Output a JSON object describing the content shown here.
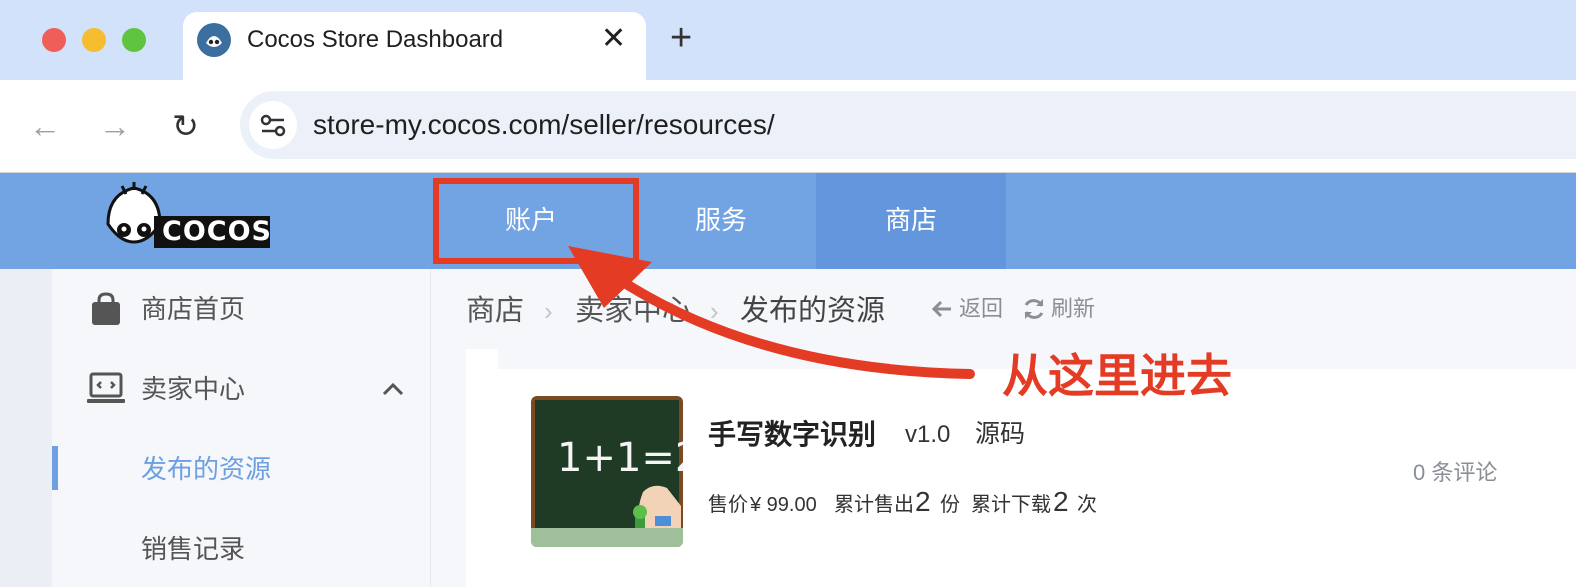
{
  "browser": {
    "tab_title": "Cocos Store Dashboard",
    "tab_close": "✕",
    "new_tab": "+",
    "url": "store-my.cocos.com/seller/resources/",
    "back": "←",
    "forward": "→",
    "reload": "↻"
  },
  "site": {
    "logo_text": "COCOS",
    "nav": [
      {
        "label": "账户"
      },
      {
        "label": "服务"
      },
      {
        "label": "商店"
      }
    ],
    "sidebar": {
      "items": [
        {
          "label": "商店首页"
        },
        {
          "label": "卖家中心"
        },
        {
          "label": "发布的资源"
        },
        {
          "label": "销售记录"
        }
      ]
    },
    "breadcrumb": [
      "商店",
      "卖家中心",
      "发布的资源"
    ],
    "breadcrumb_sep": "›",
    "back_label": "返回",
    "refresh_label": "刷新",
    "resource": {
      "title": "手写数字识别",
      "version": "v1.0",
      "type": "源码",
      "thumb_text": "1+1=2",
      "price_label": "售价",
      "price": "¥ 99.00",
      "sold_label": "累计售出",
      "sold_count": "2",
      "sold_unit": "份",
      "download_label": "累计下载",
      "download_count": "2",
      "download_unit": "次",
      "reviews": "0 条评论"
    }
  },
  "annotation": {
    "text": "从这里进去",
    "color": "#e33b24"
  },
  "colors": {
    "nav_bg": "#72a3e2",
    "nav_active": "#6496de",
    "accent": "#6d9fe1"
  }
}
